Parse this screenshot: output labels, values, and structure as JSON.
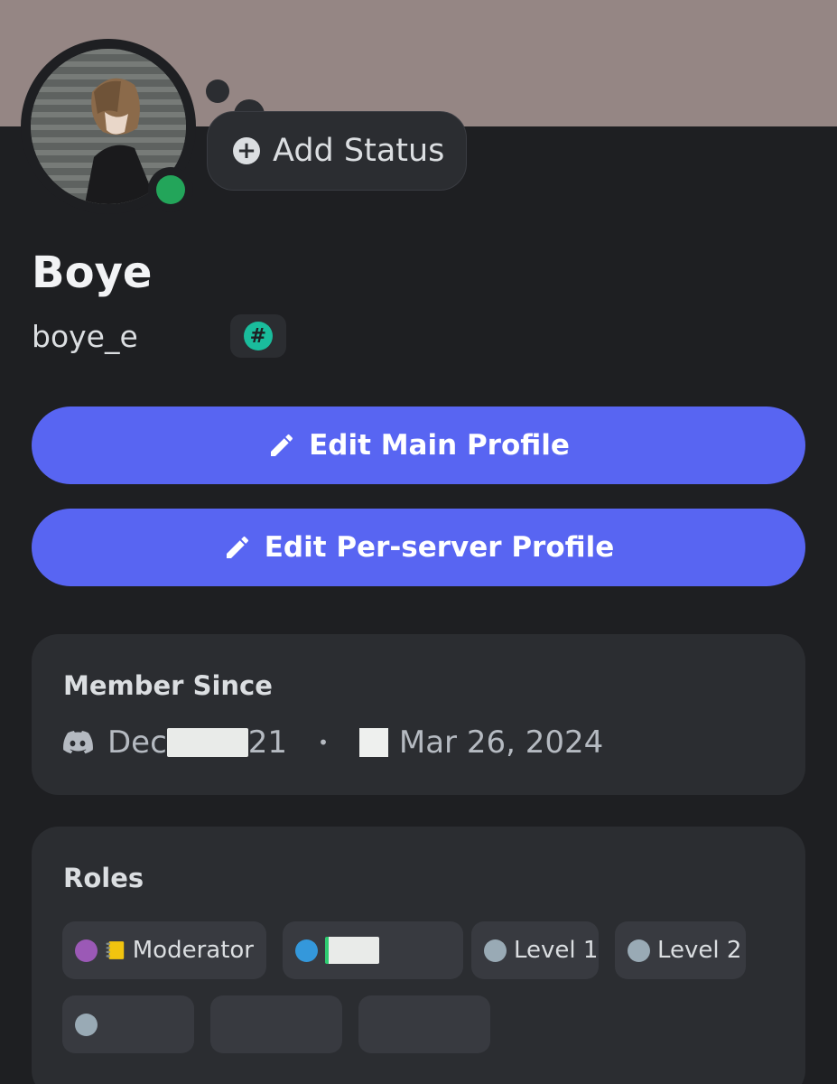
{
  "colors": {
    "banner": "#958684",
    "background": "#1e1f22",
    "card": "#2b2d31",
    "role_chip": "#383a40",
    "accent": "#5865f2",
    "online": "#23a55a"
  },
  "profile": {
    "display_name": "Boye",
    "username": "boye_e",
    "status": "online",
    "badge_icon": "hashtag-badge-icon",
    "badge_symbol": "#"
  },
  "status_bubble": {
    "label": "Add Status"
  },
  "buttons": {
    "edit_main": "Edit Main Profile",
    "edit_server": "Edit Per-server Profile"
  },
  "member_since": {
    "title": "Member Since",
    "discord_date_start": "Dec",
    "discord_date_end": "21",
    "server_date": "Mar 26, 2024"
  },
  "roles": {
    "title": "Roles",
    "items": [
      {
        "name": "Moderator",
        "color": "#9b59b6",
        "icon": "notepad-icon"
      },
      {
        "name": "",
        "color": "#3498db",
        "icon": ""
      },
      {
        "name": "Level 1",
        "color": "#99aab5",
        "icon": ""
      },
      {
        "name": "Level 2",
        "color": "#99aab5",
        "icon": ""
      },
      {
        "name": "",
        "color": "#99aab5",
        "icon": ""
      },
      {
        "name": "",
        "color": "",
        "icon": ""
      },
      {
        "name": "",
        "color": "",
        "icon": ""
      }
    ]
  }
}
